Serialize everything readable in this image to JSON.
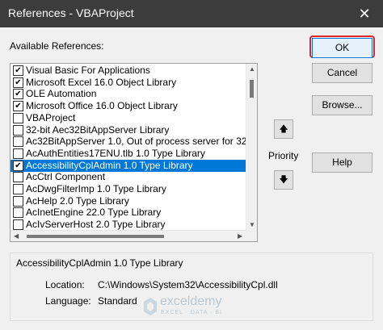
{
  "window": {
    "title": "References - VBAProject",
    "close_glyph": "✕",
    "title_bar_color": "#3c3c3c"
  },
  "available_label": "Available References:",
  "references": [
    {
      "checked": true,
      "label": "Visual Basic For Applications"
    },
    {
      "checked": true,
      "label": "Microsoft Excel 16.0 Object Library"
    },
    {
      "checked": true,
      "label": "OLE Automation"
    },
    {
      "checked": true,
      "label": "Microsoft Office 16.0 Object Library"
    },
    {
      "checked": false,
      "label": "VBAProject"
    },
    {
      "checked": false,
      "label": "32-bit Aec32BitAppServer Library"
    },
    {
      "checked": false,
      "label": "Ac32BitAppServer 1.0, Out of process server for 32"
    },
    {
      "checked": false,
      "label": "AcAuthEntities17ENU.tlb 1.0 Type Library"
    },
    {
      "checked": true,
      "label": "AccessibilityCplAdmin 1.0 Type Library",
      "selected": true
    },
    {
      "checked": false,
      "label": "AcCtrl Component"
    },
    {
      "checked": false,
      "label": "AcDwgFilterImp 1.0 Type Library"
    },
    {
      "checked": false,
      "label": "AcHelp 2.0 Type Library"
    },
    {
      "checked": false,
      "label": "AcInetEngine 22.0 Type Library"
    },
    {
      "checked": false,
      "label": "AcIvServerHost 2.0 Type Library"
    }
  ],
  "buttons": {
    "ok": "OK",
    "cancel": "Cancel",
    "browse": "Browse...",
    "help": "Help",
    "priority_label": "Priority",
    "up_glyph": "🡅",
    "down_glyph": "🡇"
  },
  "details": {
    "name": "AccessibilityCplAdmin 1.0 Type Library",
    "location_label": "Location:",
    "location_value": "C:\\Windows\\System32\\AccessibilityCpl.dll",
    "language_label": "Language:",
    "language_value": "Standard"
  },
  "watermark": {
    "name": "exceldemy",
    "tagline": "EXCEL · DATA · BI"
  },
  "colors": {
    "selection": "#0078d7",
    "ok_highlight": "#e0242c"
  }
}
